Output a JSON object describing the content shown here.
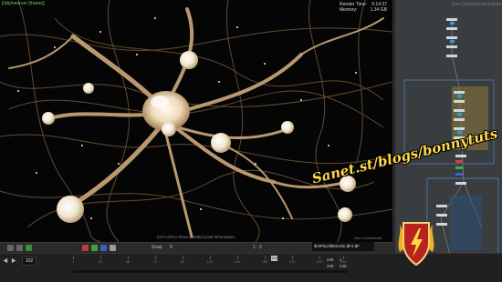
{
  "viewport": {
    "op_path": "[/obj/neuron/ (frame)]",
    "render_time_label": "Render Time:",
    "render_time_value": "0:14:37",
    "memory_label": "Memory:",
    "memory_value": "1.34 GB",
    "hint": "Ctrl+Left to show detailed pixel information.",
    "network_label": "Non-Commercial"
  },
  "network": {
    "title": "Non-Commercial Edition"
  },
  "toolbar": {
    "snap_label": "Snap",
    "snap_value": "0",
    "ratio": "1 : 2",
    "output_path": "$HIP/ipr/$IMAGE.$F4.$F"
  },
  "timeline": {
    "current_frame": "102",
    "playhead_label": "102",
    "ticks": [
      "1",
      "24",
      "48",
      "72",
      "96",
      "120",
      "144",
      "168",
      "192",
      "216",
      "240"
    ],
    "range_start": "240",
    "range_end": "240",
    "range_start_b": "1",
    "range_end_b": "240"
  },
  "watermark": {
    "text": "Sanet.st/blogs/bonnytuts"
  },
  "colors": {
    "viewport_bg": "#050505",
    "neuron": "#b99870",
    "soma_glow": "#f3ead6",
    "network_bg": "#3a3d40",
    "node_blue": "#1ea0e6",
    "watermark_yellow": "#ffd84a",
    "shield_red": "#b8231e"
  }
}
